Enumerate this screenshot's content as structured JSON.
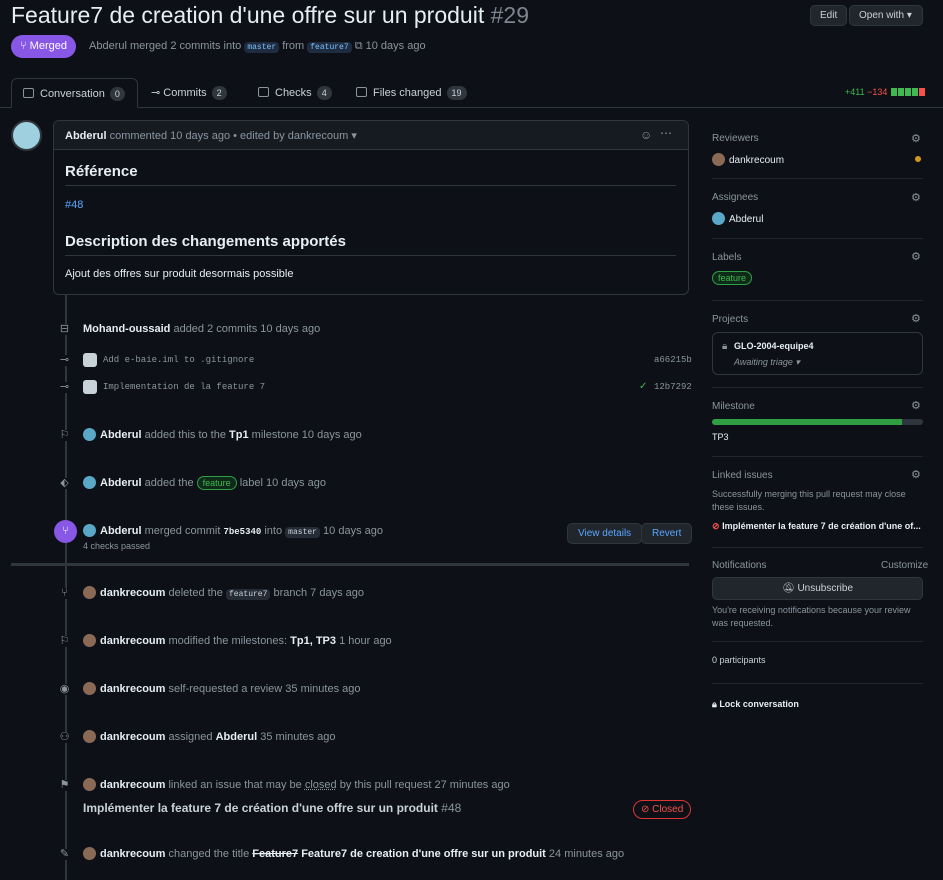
{
  "pr": {
    "title": "Feature7 de creation d'une offre sur un produit",
    "number": "#29",
    "edit_label": "Edit",
    "open_with_label": "Open with",
    "state_label": "Merged",
    "author": "Abderul",
    "merged_text": "merged 2 commits into",
    "base_branch": "master",
    "from_text": "from",
    "head_branch": "feature7",
    "time": "10 days ago"
  },
  "tabs": [
    {
      "label": "Conversation",
      "count": "0"
    },
    {
      "label": "Commits",
      "count": "2"
    },
    {
      "label": "Checks",
      "count": "4"
    },
    {
      "label": "Files changed",
      "count": "19"
    }
  ],
  "diffstat": {
    "additions": "+411",
    "deletions": "−134",
    "colors": [
      "#3fb950",
      "#3fb950",
      "#3fb950",
      "#3fb950",
      "#f85149"
    ]
  },
  "comment": {
    "author": "Abderul",
    "meta": "commented 10 days ago • edited by dankrecoum",
    "heading1": "Référence",
    "ref_link": "#48",
    "heading2": "Description des changements apportés",
    "body": "Ajout des offres sur produit desormais possible"
  },
  "timeline": {
    "commits_event": {
      "actor": "Mohand-oussaid",
      "text": "added 2 commits",
      "time": "10 days ago"
    },
    "commits": [
      {
        "message": "Add e-baie.iml to .gitignore",
        "sha": "a66215b"
      },
      {
        "message": "Implementation de la feature 7",
        "sha": "12b7292",
        "check": "✓"
      }
    ],
    "milestone_event": {
      "actor": "Abderul",
      "text": "added this to the",
      "milestone": "Tp1",
      "text2": "milestone",
      "time": "10 days ago"
    },
    "label_event": {
      "actor": "Abderul",
      "text": "added the",
      "label": "feature",
      "text2": "label",
      "time": "10 days ago"
    },
    "merge_event": {
      "actor": "Abderul",
      "text": "merged commit",
      "sha": "7be5340",
      "into": "into",
      "branch": "master",
      "time": "10 days ago",
      "checks": "4 checks passed",
      "view_details": "View details",
      "revert": "Revert"
    },
    "delete_event": {
      "actor": "dankrecoum",
      "text": "deleted the",
      "branch": "feature7",
      "text2": "branch",
      "time": "7 days ago"
    },
    "modify_milestones_event": {
      "actor": "dankrecoum",
      "text": "modified the milestones:",
      "milestones": "Tp1, TP3",
      "time": "1 hour ago"
    },
    "review_event": {
      "actor": "dankrecoum",
      "text": "self-requested a review",
      "time": "35 minutes ago"
    },
    "assign_event": {
      "actor": "dankrecoum",
      "text": "assigned",
      "assignee": "Abderul",
      "time": "35 minutes ago"
    },
    "link_event": {
      "actor": "dankrecoum",
      "text": "linked an issue that may be",
      "closed_word": "closed",
      "text2": "by this pull request",
      "time": "27 minutes ago",
      "issue_title": "Implémenter la feature 7 de création d'une offre sur un produit",
      "issue_number": "#48",
      "issue_state": "Closed"
    },
    "rename_event": {
      "actor": "dankrecoum",
      "text": "changed the title",
      "old_title": "Feature7",
      "new_title": "Feature7 de creation d'une offre sur un produit",
      "time": "24 minutes ago"
    }
  },
  "sidebar": {
    "reviewers_title": "Reviewers",
    "reviewer": "dankrecoum",
    "assignees_title": "Assignees",
    "assignee": "Abderul",
    "labels_title": "Labels",
    "label": "feature",
    "projects_title": "Projects",
    "project_name": "GLO-2004-equipe4",
    "project_status": "Awaiting triage",
    "milestone_title": "Milestone",
    "milestone_progress": 0.9,
    "milestone_name": "TP3",
    "linked_title": "Linked issues",
    "linked_note": "Successfully merging this pull request may close these issues.",
    "linked_issue": "Implémenter la feature 7 de création d'une of...",
    "notifications_title": "Notifications",
    "customize": "Customize",
    "unsubscribe": "Unsubscribe",
    "notif_note": "You're receiving notifications because your review was requested.",
    "participants": "0 participants",
    "lock": "Lock conversation"
  }
}
